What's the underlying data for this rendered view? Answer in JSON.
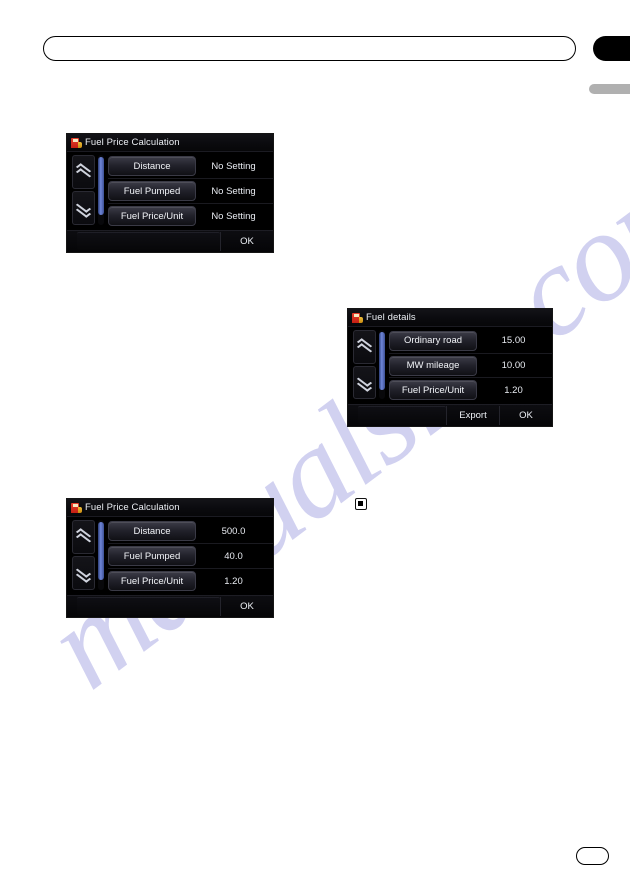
{
  "page": {
    "watermark_text": "manualslib.com",
    "watermark_color": "#c9c9ee",
    "header_tab_color": "#000000",
    "side_tab_color": "#b0b0b0"
  },
  "bullet": {
    "name": "square-bullet-marker"
  },
  "panels": [
    {
      "id": "fuel-price-calculation-initial",
      "title": "Fuel Price Calculation",
      "icon": "fuel-pump-icon",
      "rows": [
        {
          "key": "Distance",
          "value": "No Setting"
        },
        {
          "key": "Fuel Pumped",
          "value": "No Setting"
        },
        {
          "key": "Fuel Price/Unit",
          "value": "No Setting"
        }
      ],
      "footer_buttons": [
        "OK"
      ],
      "scroll_up": "scroll-up-icon",
      "scroll_down": "scroll-down-icon"
    },
    {
      "id": "fuel-details",
      "title": "Fuel details",
      "icon": "fuel-pump-icon",
      "rows": [
        {
          "key": "Ordinary road",
          "value": "15.00"
        },
        {
          "key": "MW mileage",
          "value": "10.00"
        },
        {
          "key": "Fuel Price/Unit",
          "value": "1.20"
        }
      ],
      "footer_buttons": [
        "Export",
        "OK"
      ],
      "scroll_up": "scroll-up-icon",
      "scroll_down": "scroll-down-icon"
    },
    {
      "id": "fuel-price-calculation-filled",
      "title": "Fuel Price Calculation",
      "icon": "fuel-pump-icon",
      "rows": [
        {
          "key": "Distance",
          "value": "500.0"
        },
        {
          "key": "Fuel Pumped",
          "value": "40.0"
        },
        {
          "key": "Fuel Price/Unit",
          "value": "1.20"
        }
      ],
      "footer_buttons": [
        "OK"
      ],
      "scroll_up": "scroll-up-icon",
      "scroll_down": "scroll-down-icon"
    }
  ]
}
